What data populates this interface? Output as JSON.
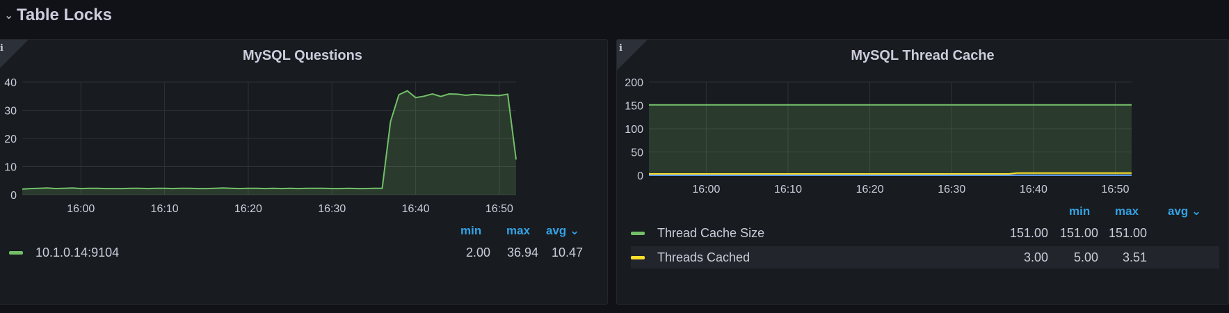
{
  "row": {
    "title": "Table Locks",
    "chevron": "chevron-down-icon"
  },
  "panels": [
    {
      "id": "a",
      "title": "MySQL Questions",
      "info_icon": "i",
      "legend": {
        "headers": [
          "min",
          "max",
          "avg"
        ],
        "sort_icon": "chevron-down-icon",
        "rows": [
          {
            "name": "10.1.0.14:9104",
            "color": "#73bf69",
            "min": "2.00",
            "max": "36.94",
            "avg": "10.47"
          }
        ]
      }
    },
    {
      "id": "b",
      "title": "MySQL Thread Cache",
      "info_icon": "i",
      "legend": {
        "headers": [
          "min",
          "max",
          "avg"
        ],
        "sort_icon": "chevron-down-icon",
        "rows": [
          {
            "name": "Thread Cache Size",
            "color": "#73bf69",
            "min": "151.00",
            "max": "151.00",
            "avg": "151.00"
          },
          {
            "name": "Threads Cached",
            "color": "#fade2a",
            "min": "3.00",
            "max": "5.00",
            "avg": "3.51"
          }
        ]
      }
    }
  ],
  "chart_data": [
    {
      "type": "area",
      "title": "MySQL Questions",
      "x_ticks": [
        "16:00",
        "16:10",
        "16:20",
        "16:30",
        "16:40",
        "16:50"
      ],
      "x_tick_minutes": [
        0,
        10,
        20,
        30,
        40,
        50
      ],
      "y_ticks": [
        0,
        10,
        20,
        30,
        40
      ],
      "ylim": [
        0,
        40
      ],
      "xlim_minutes": [
        -7,
        52
      ],
      "grid": true,
      "legend_placement": "bottom",
      "series": [
        {
          "name": "10.1.0.14:9104",
          "color": "#73bf69",
          "x_minutes": [
            -7,
            -6,
            -5,
            -4,
            -3,
            -2,
            -1,
            0,
            1,
            2,
            3,
            4,
            5,
            6,
            7,
            8,
            9,
            10,
            11,
            12,
            13,
            14,
            15,
            16,
            17,
            18,
            19,
            20,
            21,
            22,
            23,
            24,
            25,
            26,
            27,
            28,
            29,
            30,
            31,
            32,
            33,
            34,
            35,
            36,
            37,
            38,
            39,
            40,
            41,
            42,
            43,
            44,
            45,
            46,
            47,
            48,
            49,
            50,
            51,
            52
          ],
          "values": [
            2.0,
            2.2,
            2.3,
            2.4,
            2.2,
            2.3,
            2.4,
            2.2,
            2.3,
            2.3,
            2.2,
            2.2,
            2.2,
            2.3,
            2.3,
            2.2,
            2.3,
            2.3,
            2.2,
            2.3,
            2.3,
            2.2,
            2.2,
            2.3,
            2.4,
            2.3,
            2.2,
            2.3,
            2.3,
            2.2,
            2.3,
            2.2,
            2.3,
            2.2,
            2.3,
            2.3,
            2.3,
            2.2,
            2.2,
            2.3,
            2.2,
            2.2,
            2.3,
            2.3,
            26.0,
            35.5,
            36.9,
            34.5,
            35.0,
            35.8,
            34.9,
            35.8,
            35.7,
            35.3,
            35.6,
            35.4,
            35.3,
            35.2,
            35.7,
            12.5
          ]
        }
      ]
    },
    {
      "type": "area",
      "title": "MySQL Thread Cache",
      "x_ticks": [
        "16:00",
        "16:10",
        "16:20",
        "16:30",
        "16:40",
        "16:50"
      ],
      "x_tick_minutes": [
        0,
        10,
        20,
        30,
        40,
        50
      ],
      "y_ticks": [
        0,
        50,
        100,
        150,
        200
      ],
      "ylim": [
        0,
        200
      ],
      "xlim_minutes": [
        -7,
        52
      ],
      "grid": true,
      "legend_placement": "bottom",
      "series": [
        {
          "name": "Thread Cache Size",
          "color": "#73bf69",
          "x_minutes": [
            -7,
            52
          ],
          "values": [
            151,
            151
          ]
        },
        {
          "name": "Threads Cached",
          "color": "#fade2a",
          "x_minutes": [
            -7,
            37,
            38,
            52
          ],
          "values": [
            3,
            3,
            5,
            5
          ]
        },
        {
          "color": "#5794f2",
          "x_minutes": [
            -7,
            52
          ],
          "values": [
            0,
            0
          ]
        }
      ]
    }
  ]
}
